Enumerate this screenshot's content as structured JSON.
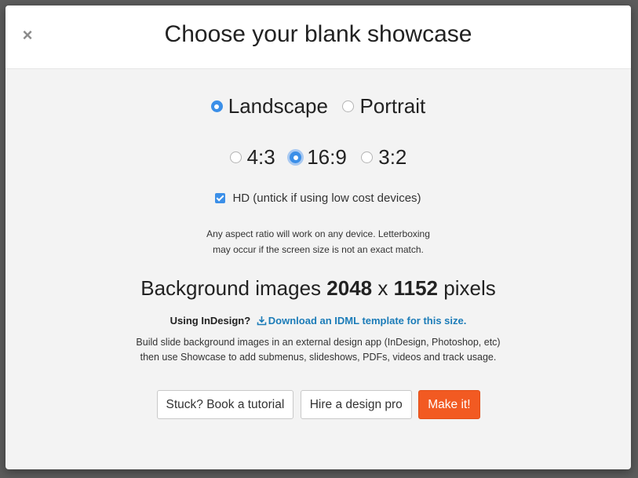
{
  "dialog": {
    "title": "Choose your blank showcase",
    "close_glyph": "×"
  },
  "orientation": {
    "options": [
      {
        "label": "Landscape",
        "checked": true
      },
      {
        "label": "Portrait",
        "checked": false
      }
    ]
  },
  "aspect_ratio": {
    "options": [
      {
        "label": "4:3",
        "checked": false
      },
      {
        "label": "16:9",
        "checked": true
      },
      {
        "label": "3:2",
        "checked": false
      }
    ]
  },
  "hd": {
    "label": "HD (untick if using low cost devices)",
    "checked": true
  },
  "note": {
    "line1": "Any aspect ratio will work on any device. Letterboxing",
    "line2": "may occur if the screen size is not an exact match."
  },
  "background": {
    "prefix": "Background images",
    "width": "2048",
    "x": "x",
    "height": "1152",
    "suffix": "pixels"
  },
  "indesign": {
    "prompt": "Using InDesign?",
    "link": "Download an IDML template for this size."
  },
  "build": {
    "line1": "Build slide background images in an external design app (InDesign, Photoshop, etc)",
    "line2": "then use Showcase to add submenus, slideshows, PDFs, videos and track usage."
  },
  "buttons": {
    "tutorial": "Stuck? Book a tutorial",
    "hire": "Hire a design pro",
    "make": "Make it!"
  },
  "colors": {
    "accent": "#3b8fe8",
    "primary_button": "#f25a22",
    "link": "#1c7cb8"
  }
}
